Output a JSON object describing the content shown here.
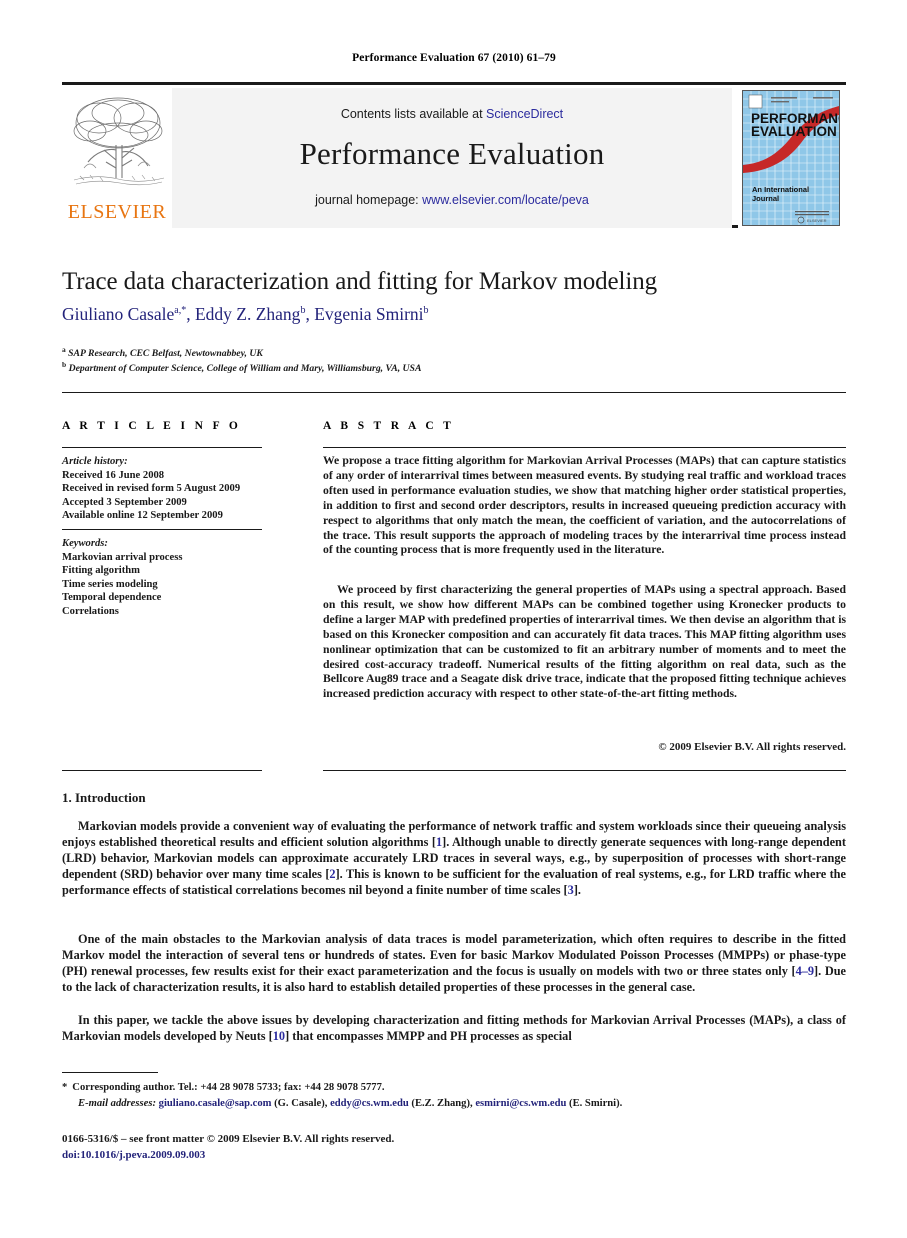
{
  "running_head": "Performance Evaluation 67 (2010) 61–79",
  "masthead": {
    "publisher_name": "ELSEVIER",
    "contents_prefix": "Contents lists available at ",
    "contents_link": "ScienceDirect",
    "journal_title": "Performance Evaluation",
    "homepage_prefix": "journal homepage: ",
    "homepage_url": "www.elsevier.com/locate/peva",
    "cover": {
      "title_line1": "PERFORMANCE",
      "title_line2": "EVALUATION",
      "subtitle_line1": "An International",
      "subtitle_line2": "Journal"
    }
  },
  "article": {
    "title": "Trace data characterization and fitting for Markov modeling",
    "authors": [
      {
        "name": "Giuliano Casale",
        "marks": "a,*"
      },
      {
        "name": "Eddy Z. Zhang",
        "marks": "b"
      },
      {
        "name": "Evgenia Smirni",
        "marks": "b"
      }
    ],
    "affiliations": [
      {
        "mark": "a",
        "text": "SAP Research, CEC Belfast, Newtownabbey, UK"
      },
      {
        "mark": "b",
        "text": "Department of Computer Science, College of William and Mary, Williamsburg, VA, USA"
      }
    ]
  },
  "info": {
    "heading": "A R T I C L E   I N F O",
    "history_label": "Article history:",
    "history": [
      "Received 16 June 2008",
      "Received in revised form 5 August 2009",
      "Accepted 3 September 2009",
      "Available online 12 September 2009"
    ],
    "keywords_label": "Keywords:",
    "keywords": [
      "Markovian arrival process",
      "Fitting algorithm",
      "Time series modeling",
      "Temporal dependence",
      "Correlations"
    ]
  },
  "abstract": {
    "heading": "A B S T R A C T",
    "paragraph1": "We propose a trace fitting algorithm for Markovian Arrival Processes (MAPs) that can capture statistics of any order of interarrival times between measured events. By studying real traffic and workload traces often used in performance evaluation studies, we show that matching higher order statistical properties, in addition to first and second order descriptors, results in increased queueing prediction accuracy with respect to algorithms that only match the mean, the coefficient of variation, and the autocorrelations of the trace. This result supports the approach of modeling traces by the interarrival time process instead of the counting process that is more frequently used in the literature.",
    "paragraph2": "We proceed by first characterizing the general properties of MAPs using a spectral approach. Based on this result, we show how different MAPs can be combined together using Kronecker products to define a larger MAP with predefined properties of interarrival times. We then devise an algorithm that is based on this Kronecker composition and can accurately fit data traces. This MAP fitting algorithm uses nonlinear optimization that can be customized to fit an arbitrary number of moments and to meet the desired cost-accuracy tradeoff. Numerical results of the fitting algorithm on real data, such as the Bellcore Aug89 trace and a Seagate disk drive trace, indicate that the proposed fitting technique achieves increased prediction accuracy with respect to other state-of-the-art fitting methods.",
    "copyright": "© 2009 Elsevier B.V. All rights reserved."
  },
  "introduction": {
    "heading": "1. Introduction",
    "paragraphs": [
      {
        "parts": [
          {
            "t": "Markovian models provide a convenient way of evaluating the performance of network traffic and system workloads since their queueing analysis enjoys established theoretical results and efficient solution algorithms [",
            "ref": false
          },
          {
            "t": "1",
            "ref": true
          },
          {
            "t": "]. Although unable to directly generate sequences with long-range dependent (LRD) behavior, Markovian models can approximate accurately LRD traces in several ways, e.g., by superposition of processes with short-range dependent (SRD) behavior over many time scales [",
            "ref": false
          },
          {
            "t": "2",
            "ref": true
          },
          {
            "t": "]. This is known to be sufficient for the evaluation of real systems, e.g., for LRD traffic where the performance effects of statistical correlations becomes nil beyond a finite number of time scales [",
            "ref": false
          },
          {
            "t": "3",
            "ref": true
          },
          {
            "t": "].",
            "ref": false
          }
        ]
      },
      {
        "parts": [
          {
            "t": "One of the main obstacles to the Markovian analysis of data traces is model parameterization, which often requires to describe in the fitted Markov model the interaction of several tens or hundreds of states. Even for basic Markov Modulated Poisson Processes (MMPPs) or phase-type (PH) renewal processes, few results exist for their exact parameterization and the focus is usually on models with two or three states only [",
            "ref": false
          },
          {
            "t": "4–9",
            "ref": true
          },
          {
            "t": "]. Due to the lack of characterization results, it is also hard to establish detailed properties of these processes in the general case.",
            "ref": false
          }
        ]
      },
      {
        "parts": [
          {
            "t": "In this paper, we tackle the above issues by developing characterization and fitting methods for Markovian Arrival Processes (MAPs), a class of Markovian models developed by Neuts [",
            "ref": false
          },
          {
            "t": "10",
            "ref": true
          },
          {
            "t": "] that encompasses MMPP and PH processes as special",
            "ref": false
          }
        ]
      }
    ]
  },
  "footnotes": {
    "corresponding_marker": "*",
    "corresponding": "Corresponding author. Tel.: +44 28 9078 5733; fax: +44 28 9078 5777.",
    "email_label": "E-mail addresses:",
    "emails": [
      {
        "address": "giuliano.casale@sap.com",
        "person": " (G. Casale), "
      },
      {
        "address": "eddy@cs.wm.edu",
        "person": " (E.Z. Zhang), "
      },
      {
        "address": "esmirni@cs.wm.edu",
        "person": " (E. Smirni)."
      }
    ],
    "issn_line": "0166-5316/$ – see front matter © 2009 Elsevier B.V. All rights reserved.",
    "doi_line": "doi:10.1016/j.peva.2009.09.003"
  },
  "colors": {
    "link": "#2b2b9e",
    "author": "#23237a",
    "elsevier_orange": "#e87511",
    "cover_blue": "#8fc7e8",
    "cover_red": "#c62828",
    "mast_bg": "#f3f3f3"
  }
}
